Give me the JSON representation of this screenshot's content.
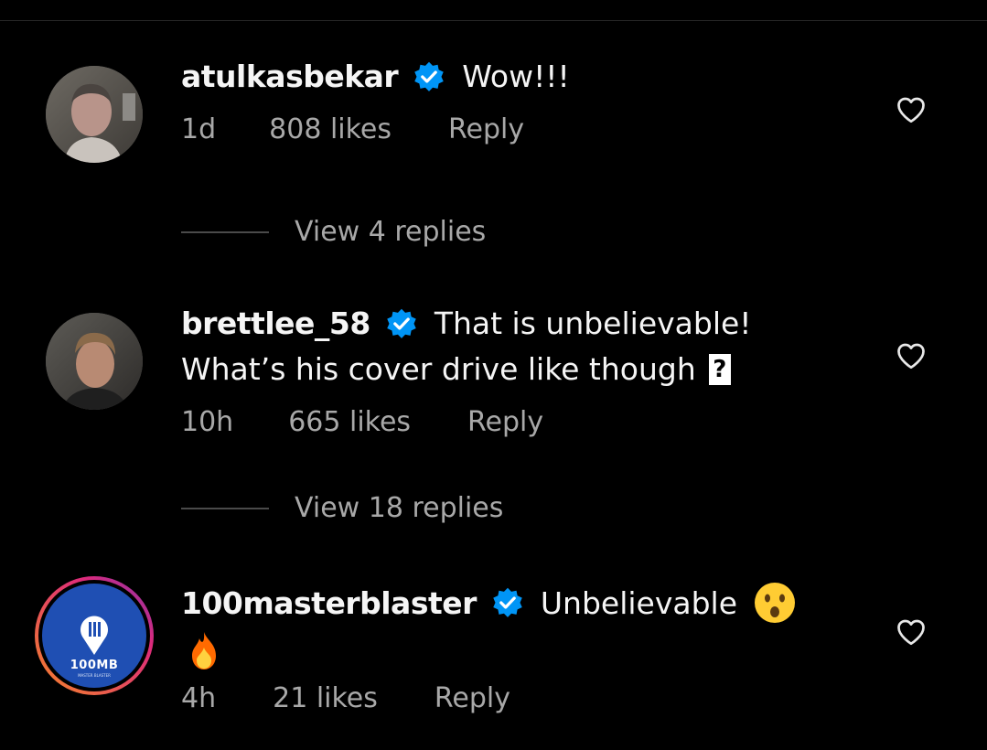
{
  "comments": [
    {
      "username": "atulkasbekar",
      "text": "Wow!!!",
      "text2": "",
      "time": "1d",
      "likes": "808 likes",
      "reply": "Reply",
      "view_replies": "View 4 replies"
    },
    {
      "username": "brettlee_58",
      "text": "That is unbelievable!",
      "text2": "What’s his cover drive like though",
      "unknown_glyph": "?",
      "time": "10h",
      "likes": "665 likes",
      "reply": "Reply",
      "view_replies": "View 18 replies"
    },
    {
      "username": "100masterblaster",
      "text": "Unbelievable",
      "text2": "",
      "avatar_logo": "100MB",
      "avatar_sub": "MASTER BLASTER",
      "time": "4h",
      "likes": "21 likes",
      "reply": "Reply"
    }
  ],
  "colors": {
    "background": "#000000",
    "verified": "#0095f6",
    "meta": "#a8a8a8",
    "story_ring": [
      "#f58529",
      "#dd2a7b"
    ]
  },
  "icons": [
    "verified-badge-icon",
    "heart-icon",
    "astonished-emoji-icon",
    "fire-emoji-icon"
  ]
}
